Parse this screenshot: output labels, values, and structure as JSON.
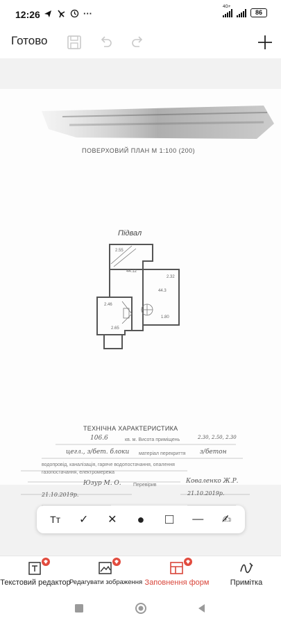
{
  "status_bar": {
    "time": "12:26",
    "network_label": "4G+",
    "battery": "86"
  },
  "header": {
    "done_label": "Готово"
  },
  "document": {
    "scan_title": "ПОВЕРХОВИЙ ПЛАН  М  1:100 (200)",
    "plan_label": "Підвал",
    "tech_title": "ТЕХНІЧНА ХАРАКТЕРИСТИКА",
    "room_labels": [
      "2.55",
      "2.32",
      "44.3",
      "44.12",
      "2.46",
      "2.65",
      "1.80"
    ],
    "handwritten": {
      "line1": "106.6",
      "line1_suffix": "кв. м. Висота приміщень",
      "line1_values": "2.30, 2.50, 2.30",
      "line2": "цегл., з/бет. блоки",
      "line2_suffix": "матеріал перекриття",
      "line2_value": "з/бетон",
      "line3": "водопровід, каналізація, гаряче водопостачання, опалення",
      "line4": "газопостачання, електромережа",
      "sign_left": "Юзур  М. О.",
      "sign_right": "Коваленко Ж.Р.",
      "date_left": "21.10.2019р.",
      "date_right": "21.10.2019р.",
      "check": "Перевірив"
    }
  },
  "tools": [
    {
      "name": "text-size-tool",
      "glyph": "Tт"
    },
    {
      "name": "check-tool",
      "glyph": "✓"
    },
    {
      "name": "cross-tool",
      "glyph": "✕"
    },
    {
      "name": "dot-tool",
      "glyph": "●"
    },
    {
      "name": "rectangle-tool",
      "glyph": "□"
    },
    {
      "name": "line-tool",
      "glyph": "—"
    },
    {
      "name": "sign-tool",
      "glyph": "✍"
    }
  ],
  "tabs": [
    {
      "label": "Текстовий редактор",
      "active": false,
      "badge": true
    },
    {
      "label": "Редагувати зображення",
      "active": false,
      "badge": true
    },
    {
      "label": "Заповнення форм",
      "active": true,
      "badge": true
    },
    {
      "label": "Примітка",
      "active": false,
      "badge": false
    }
  ],
  "colors": {
    "accent": "#d9453a",
    "badge": "#e24c3f"
  }
}
